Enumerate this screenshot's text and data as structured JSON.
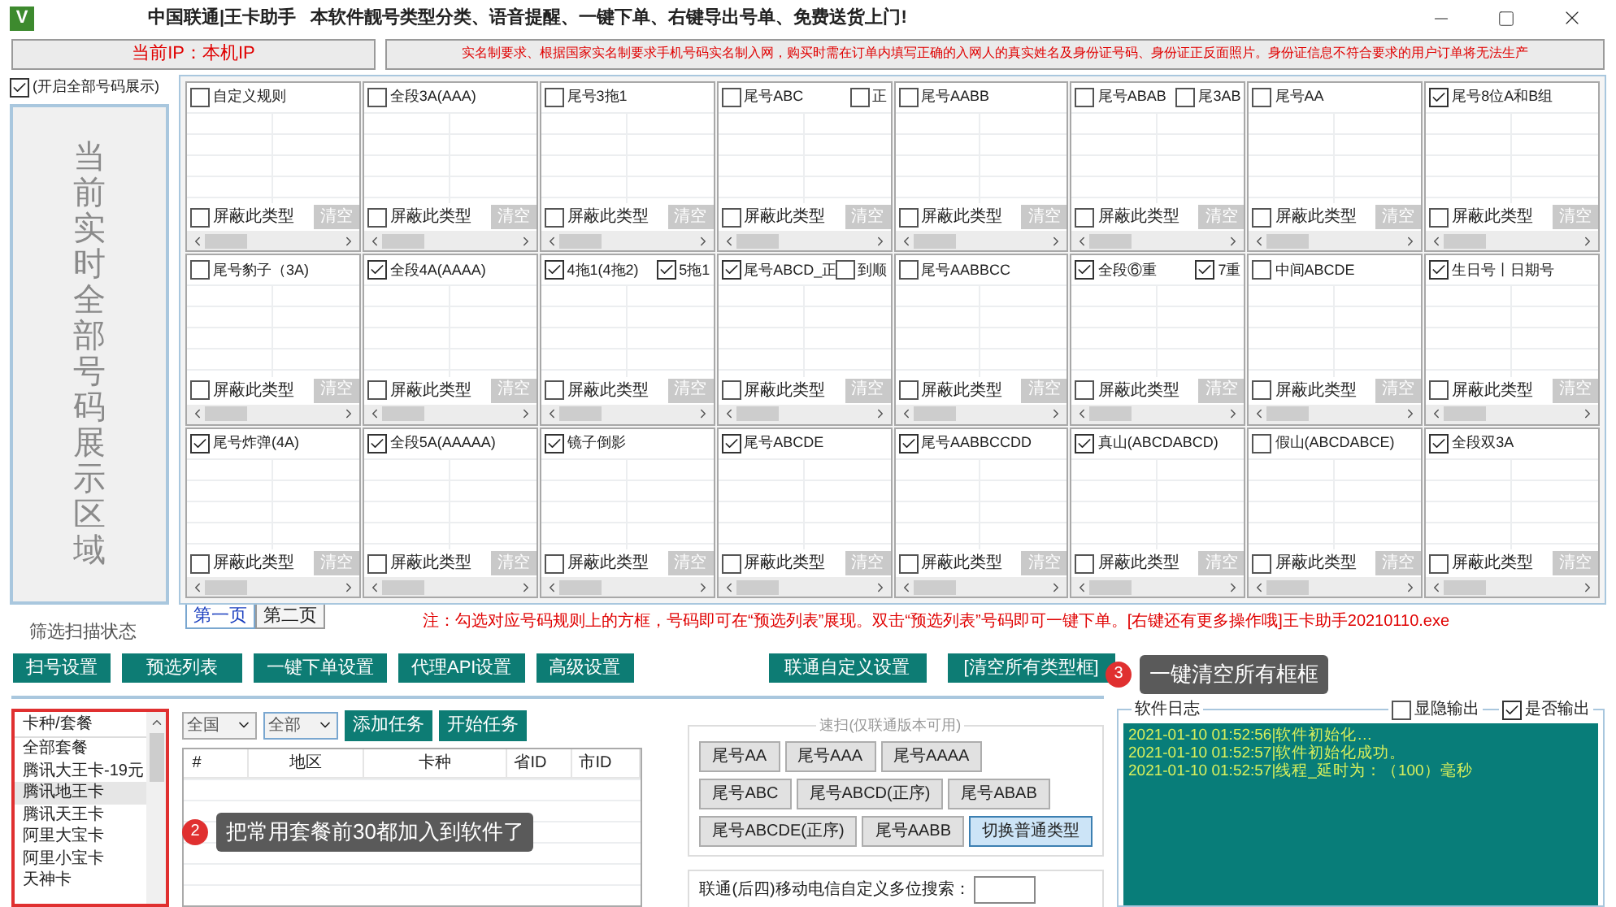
{
  "window": {
    "logo_letter": "V",
    "title": "中国联通|王卡助手   本软件靓号类型分类、语音提醒、一键下单、右键导出号单、免费送货上门!"
  },
  "info_bar": {
    "ip": "当前IP：本机IP",
    "notice": "实名制要求、根据国家实名制要求手机号码实名制入网，购买时需在订单内填写正确的入网人的真实姓名及身份证号码、身份证正反面照片。身份证信息不符合要求的用户订单将无法生产"
  },
  "show_all": {
    "label": "(开启全部号码展示)",
    "checked": true
  },
  "display_area": "当前实时全部号码展示区域",
  "rule_panels": [
    {
      "label": "自定义规则",
      "checked": false,
      "block": {
        "label": "屏蔽此类型",
        "checked": false
      },
      "clear": "清空"
    },
    {
      "label": "全段3A(AAA)",
      "checked": false,
      "block": {
        "label": "屏蔽此类型",
        "checked": false
      },
      "clear": "清空"
    },
    {
      "label": "尾号3拖1",
      "checked": false,
      "block": {
        "label": "屏蔽此类型",
        "checked": false
      },
      "clear": "清空"
    },
    {
      "label": "尾号ABC",
      "checked": false,
      "extra": {
        "label": "正",
        "checked": false
      },
      "block": {
        "label": "屏蔽此类型",
        "checked": false
      },
      "clear": "清空"
    },
    {
      "label": "尾号AABB",
      "checked": false,
      "block": {
        "label": "屏蔽此类型",
        "checked": false
      },
      "clear": "清空"
    },
    {
      "label": "尾号ABAB",
      "checked": false,
      "extra": {
        "label": "尾3AB",
        "checked": false
      },
      "block": {
        "label": "屏蔽此类型",
        "checked": false
      },
      "clear": "清空"
    },
    {
      "label": "尾号AA",
      "checked": false,
      "block": {
        "label": "屏蔽此类型",
        "checked": false
      },
      "clear": "清空"
    },
    {
      "label": "尾号8位A和B组",
      "checked": true,
      "block": {
        "label": "屏蔽此类型",
        "checked": false
      },
      "clear": "清空"
    },
    {
      "label": "尾号豹子（3A)",
      "checked": false,
      "block": {
        "label": "屏蔽此类型",
        "checked": false
      },
      "clear": "清空"
    },
    {
      "label": "全段4A(AAAA)",
      "checked": true,
      "block": {
        "label": "屏蔽此类型",
        "checked": false
      },
      "clear": "清空"
    },
    {
      "label": "4拖1(4拖2)",
      "checked": true,
      "extra": {
        "label": "5拖1",
        "checked": true
      },
      "block": {
        "label": "屏蔽此类型",
        "checked": false
      },
      "clear": "清空"
    },
    {
      "label": "尾号ABCD_正",
      "checked": true,
      "extra": {
        "label": "到顺",
        "checked": false
      },
      "block": {
        "label": "屏蔽此类型",
        "checked": false
      },
      "clear": "清空"
    },
    {
      "label": "尾号AABBCC",
      "checked": false,
      "block": {
        "label": "屏蔽此类型",
        "checked": false
      },
      "clear": "清空"
    },
    {
      "label": "全段⑥重",
      "checked": true,
      "extra": {
        "label": "7重",
        "checked": true
      },
      "block": {
        "label": "屏蔽此类型",
        "checked": false
      },
      "clear": "清空"
    },
    {
      "label": "中间ABCDE",
      "checked": false,
      "block": {
        "label": "屏蔽此类型",
        "checked": false
      },
      "clear": "清空"
    },
    {
      "label": "生日号丨日期号",
      "checked": true,
      "block": {
        "label": "屏蔽此类型",
        "checked": false
      },
      "clear": "清空"
    },
    {
      "label": "尾号炸弹(4A)",
      "checked": true,
      "block": {
        "label": "屏蔽此类型",
        "checked": false
      },
      "clear": "清空"
    },
    {
      "label": "全段5A(AAAAA)",
      "checked": true,
      "block": {
        "label": "屏蔽此类型",
        "checked": false
      },
      "clear": "清空"
    },
    {
      "label": "镜子倒影",
      "checked": true,
      "block": {
        "label": "屏蔽此类型",
        "checked": false
      },
      "clear": "清空"
    },
    {
      "label": "尾号ABCDE",
      "checked": true,
      "block": {
        "label": "屏蔽此类型",
        "checked": false
      },
      "clear": "清空"
    },
    {
      "label": "尾号AABBCCDD",
      "checked": true,
      "block": {
        "label": "屏蔽此类型",
        "checked": false
      },
      "clear": "清空"
    },
    {
      "label": "真山(ABCDABCD)",
      "checked": true,
      "block": {
        "label": "屏蔽此类型",
        "checked": false
      },
      "clear": "清空"
    },
    {
      "label": "假山(ABCDABCE)",
      "checked": false,
      "block": {
        "label": "屏蔽此类型",
        "checked": false
      },
      "clear": "清空"
    },
    {
      "label": "全段双3A",
      "checked": true,
      "block": {
        "label": "屏蔽此类型",
        "checked": false
      },
      "clear": "清空"
    }
  ],
  "status_label": "筛选扫描状态",
  "tabs": [
    {
      "label": "第一页",
      "selected": true
    },
    {
      "label": "第二页",
      "selected": false
    }
  ],
  "note": "注：勾选对应号码规则上的方框，号码即可在“预选列表”展现。双击“预选列表”号码即可一键下单。[右键还有更多操作哦]王卡助手20210110.exe",
  "toolbar": [
    "扫号设置",
    "预选列表",
    "一键下单设置",
    "代理API设置",
    "高级设置"
  ],
  "toolbar_right": [
    "联通自定义设置",
    "[清空所有类型框]"
  ],
  "package_list": {
    "header": "卡种/套餐",
    "items": [
      {
        "label": "全部套餐",
        "selected": false
      },
      {
        "label": "腾讯大王卡-19元",
        "selected": false
      },
      {
        "label": "腾讯地王卡",
        "selected": true
      },
      {
        "label": "腾讯天王卡",
        "selected": false
      },
      {
        "label": "阿里大宝卡",
        "selected": false
      },
      {
        "label": "阿里小宝卡",
        "selected": false
      },
      {
        "label": "天神卡",
        "selected": false
      }
    ]
  },
  "filters": {
    "region": "全国",
    "scope": "全部",
    "buttons": [
      "添加任务",
      "开始任务"
    ]
  },
  "task_table": {
    "columns": [
      "#",
      "地区",
      "卡种",
      "省ID",
      "市ID"
    ]
  },
  "quick_scan": {
    "title": "速扫(仅联通版本可用)",
    "rows": [
      [
        {
          "label": "尾号AA",
          "kind": "scan"
        },
        {
          "label": "尾号AAA",
          "kind": "scan"
        },
        {
          "label": "尾号AAAA",
          "kind": "scan"
        }
      ],
      [
        {
          "label": "尾号ABC",
          "kind": "scan"
        },
        {
          "label": "尾号ABCD(正序)",
          "kind": "scan"
        },
        {
          "label": "尾号ABAB",
          "kind": "scan"
        }
      ],
      [
        {
          "label": "尾号ABCDE(正序)",
          "kind": "scan"
        },
        {
          "label": "尾号AABB",
          "kind": "scan"
        },
        {
          "label": "切换普通类型",
          "kind": "switch"
        }
      ]
    ]
  },
  "custom_search": {
    "label": "联通(后四)移动电信自定义多位搜索："
  },
  "log": {
    "title": "软件日志",
    "toggles": [
      {
        "label": "显隐输出",
        "checked": false
      },
      {
        "label": "是否输出",
        "checked": true
      }
    ],
    "lines": [
      "2021-01-10 01:52:56|软件初始化…",
      "2021-01-10 01:52:57|软件初始化成功。",
      "2021-01-10 01:52:57|线程_延时为：（100）毫秒"
    ]
  },
  "callouts": [
    {
      "number": "2",
      "text": "把常用套餐前30都加入到软件了"
    },
    {
      "number": "3",
      "text": "一键清空所有框框"
    }
  ]
}
